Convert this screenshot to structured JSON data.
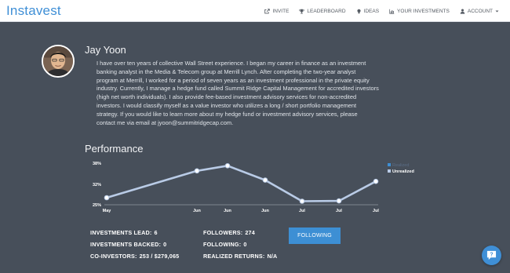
{
  "navbar": {
    "brand": "Instavest",
    "items": [
      {
        "label": "INVITE",
        "icon": "external-link-icon"
      },
      {
        "label": "LEADERBOARD",
        "icon": "trophy-icon"
      },
      {
        "label": "IDEAS",
        "icon": "lightbulb-icon"
      },
      {
        "label": "YOUR INVESTMENTS",
        "icon": "bar-chart-icon"
      },
      {
        "label": "ACCOUNT",
        "icon": "user-icon",
        "caret": "chevron-down-icon"
      }
    ]
  },
  "profile": {
    "name": "Jay Yoon",
    "bio": "I have over ten years of collective Wall Street experience. I began my career in finance as an investment\nbanking analyst in the Media & Telecom group at Merrill Lynch. After completing the two-year analyst\nprogram at Merrill, I worked for a period of seven years as an investment professional in the private equity\nindustry. Currently, I manage a hedge fund called Summit Ridge Capital Management for accredited investors\n(high net worth individuals). I also provide fee-based investment advisory services for non-accredited\ninvestors. I would classify myself as a value investor who utilizes a long / short portfolio management\nstrategy. If you would like to learn more about my hedge fund or investment advisory services, please\ncontact me via email at jyoon@summitridgecap.com."
  },
  "performance": {
    "title": "Performance"
  },
  "chart_data": {
    "type": "line",
    "categories": [
      "May",
      "Jun",
      "Jun",
      "Jun",
      "Jul",
      "Jul",
      "Jul"
    ],
    "y_ticks": [
      "38%",
      "32%",
      "25%"
    ],
    "ylim": [
      25,
      38
    ],
    "series": [
      {
        "name": "Unrealized",
        "values": [
          27.2,
          35.6,
          37.2,
          32.7,
          26.1,
          26.2,
          32.3
        ],
        "color": "#b9cbe6"
      }
    ],
    "legend": [
      "Realized",
      "Unrealized"
    ],
    "legend_position": "top-right",
    "colors": {
      "realized": "#3d8fd4",
      "unrealized": "#b9cbe6"
    }
  },
  "stats": {
    "investments_lead_label": "INVESTMENTS LEAD:",
    "investments_lead": "6",
    "investments_backed_label": "INVESTMENTS BACKED:",
    "investments_backed": "0",
    "co_investors_label": "CO-INVESTORS:",
    "co_investors": "253 / $279,065",
    "followers_label": "FOLLOWERS:",
    "followers": "274",
    "following_label": "FOLLOWING:",
    "following": "0",
    "realized_returns_label": "REALIZED RETURNS:",
    "realized_returns": "N/A"
  },
  "follow_button": "FOLLOWING",
  "help": {
    "icon": "help-chat-icon"
  },
  "colors": {
    "accent": "#3d8fd4",
    "background": "#474f5a",
    "line": "#b9cbe6"
  }
}
